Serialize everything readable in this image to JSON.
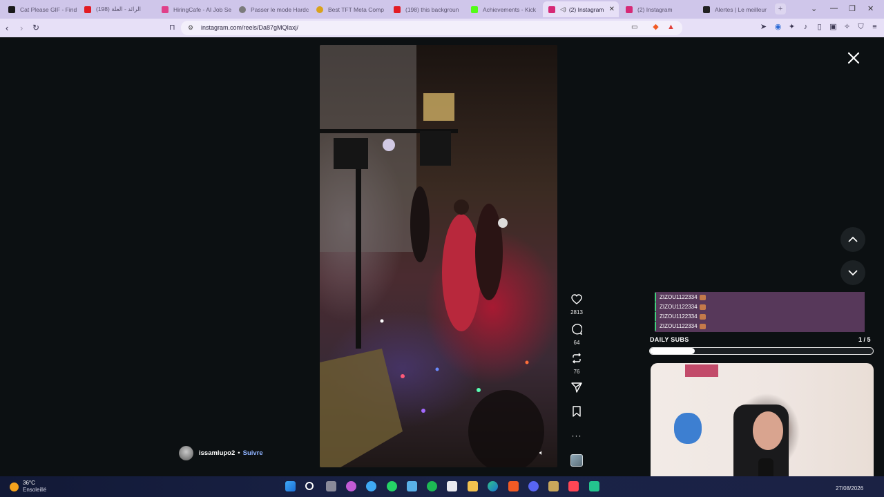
{
  "browser": {
    "tabs": [
      {
        "label": "Cat Please GIF - Find",
        "color": "#1a1a1a",
        "active": false
      },
      {
        "label": "(198) الرائد - العلة",
        "color": "#e21b23",
        "active": false
      },
      {
        "label": "HiringCafe - AI Job Se",
        "color": "#e0408a",
        "active": false
      },
      {
        "label": "Passer le mode Hardc",
        "color": "#7b7b7b",
        "active": false
      },
      {
        "label": "Best TFT Meta Comp",
        "color": "#d9a21b",
        "active": false
      },
      {
        "label": "(198) this backgroun",
        "color": "#e21b23",
        "active": false
      },
      {
        "label": "Achievements - Kick",
        "color": "#53fc18",
        "active": false
      },
      {
        "label": "(2) Instagram",
        "color": "#d62976",
        "active": true
      },
      {
        "label": "(2) Instagram",
        "color": "#d62976",
        "active": false
      },
      {
        "label": "Alertes | Le meilleur",
        "color": "#222222",
        "active": false
      }
    ],
    "new_tab": "+",
    "url": "instagram.com/reels/Da87gMQIaxj/"
  },
  "reel": {
    "likes": "2813",
    "comments": "64",
    "reposts": "76",
    "username": "issamlupo2",
    "separator": "•",
    "follow": "Suivre"
  },
  "overlay": {
    "chat": [
      "ZIZOU1122334",
      "ZIZOU1122334",
      "ZIZOU1122334",
      "ZIZOU1122334"
    ],
    "subs_title": "DAILY SUBS",
    "subs_count": "1 / 5",
    "subs_progress": 0.2
  },
  "taskbar": {
    "temperature": "36°C",
    "weather": "Ensoleillé",
    "date": "27/08/2026"
  },
  "colors": {
    "accent_follow": "#8fb3ff",
    "tab_bar": "#cfc6ea",
    "chat_border": "#3fd07a"
  }
}
